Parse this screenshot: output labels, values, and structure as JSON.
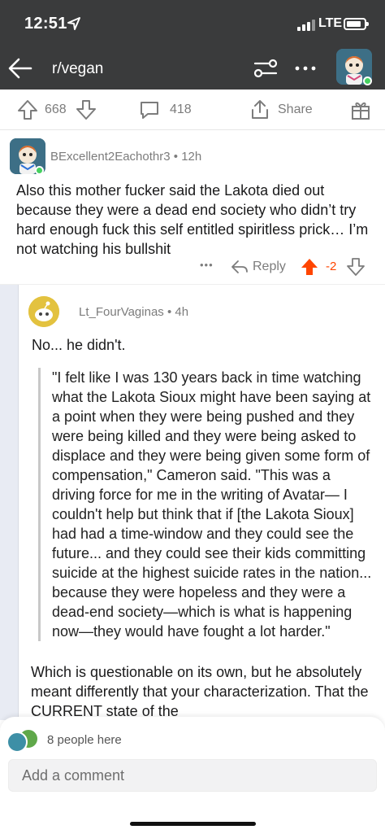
{
  "status_bar": {
    "time": "12:51",
    "network": "LTE"
  },
  "header": {
    "subreddit": "r/vegan",
    "icons": [
      "back-arrow-icon",
      "filter-icon",
      "more-icon"
    ]
  },
  "action_bar": {
    "score": "668",
    "comments_count": "418",
    "share_label": "Share"
  },
  "comment1": {
    "author": "BExcellent2Eachothr3",
    "separator": "•",
    "age": "12h",
    "body": "Also this mother fucker said the Lakota died out because they were a dead end society who didn’t try hard enough fuck this self entitled spiritless prick… I’m not watching his bullshit",
    "more": "•••",
    "reply_label": "Reply",
    "score": "-2",
    "upvoted_color": "#ff4500"
  },
  "comment2": {
    "author": "Lt_FourVaginas",
    "separator": "•",
    "age": "4h",
    "opening": "No... he didn't.",
    "quote": "\"I felt like I was 130 years back in time watching what the Lakota Sioux might have been saying at a point when they were being pushed and they were being killed and they were being asked to displace and they were being given some form of compensation,\" Cameron said. \"This was a driving force for me in the writing of Avatar— I couldn't help but think that if [the Lakota Sioux] had had a time-window and they could see the future... and they could see their kids committing suicide at the highest suicide rates in the nation... because they were hopeless and they were a dead-end society—which is what is happening now—they would have fought a lot harder.\"",
    "followup": "Which is questionable on its own, but he absolutely meant differently that your characterization. That the CURRENT state of the"
  },
  "bottom_sheet": {
    "presence": "8 people here",
    "comment_placeholder": "Add a comment"
  }
}
